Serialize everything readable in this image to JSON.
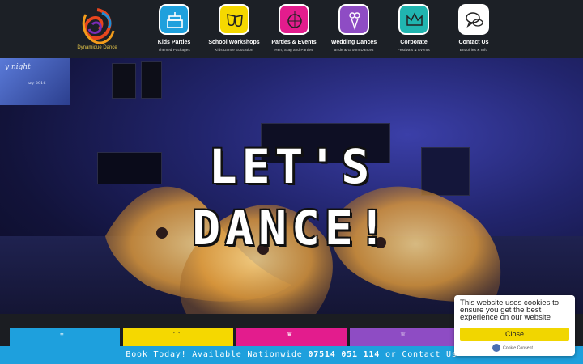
{
  "brand": {
    "logo_text": "Dynamique Dance"
  },
  "nav": {
    "items": [
      {
        "label": "Kids Parties",
        "sub": "Themed Packages",
        "color": "#1ea0dd",
        "icon": "birthday-cake-icon"
      },
      {
        "label": "School Workshops",
        "sub": "Kids Dance Education",
        "color": "#f5d800",
        "icon": "theatre-masks-icon"
      },
      {
        "label": "Parties & Events",
        "sub": "Hen, Stag and Parties",
        "color": "#e31c8d",
        "icon": "disco-ball-icon"
      },
      {
        "label": "Wedding Dances",
        "sub": "Bride & Groom Dances",
        "color": "#8e4cc4",
        "icon": "bouquet-icon"
      },
      {
        "label": "Corporate",
        "sub": "Festivals & Events",
        "color": "#20b5b0",
        "icon": "crown-icon"
      },
      {
        "label": "Contact Us",
        "sub": "Enquiries & Info",
        "color": "#ffffff",
        "icon": "speech-bubbles-icon"
      }
    ]
  },
  "hero": {
    "title_line1": "LET'S",
    "title_line2": "DANCE!",
    "screen_text": "y night",
    "screen_text2": "ary 2016"
  },
  "cards": [
    {
      "color": "#1ea0dd",
      "icon": "cake-icon"
    },
    {
      "color": "#f5d800",
      "icon": "mask-icon"
    },
    {
      "color": "#e31c8d",
      "icon": "crown-icon"
    },
    {
      "color": "#8e4cc4",
      "icon": "ring-icon"
    }
  ],
  "bottom_bar": {
    "prefix": "Book Today! Available Nationwide ",
    "phone": "07514 051 114",
    "suffix": " or Contact Us",
    "color": "#1ea0dd"
  },
  "cookie": {
    "message": "This website uses cookies to ensure you get the best experience on our website",
    "button_label": "Close",
    "brand_label": "Cookie Consent",
    "button_color": "#f1d600"
  }
}
